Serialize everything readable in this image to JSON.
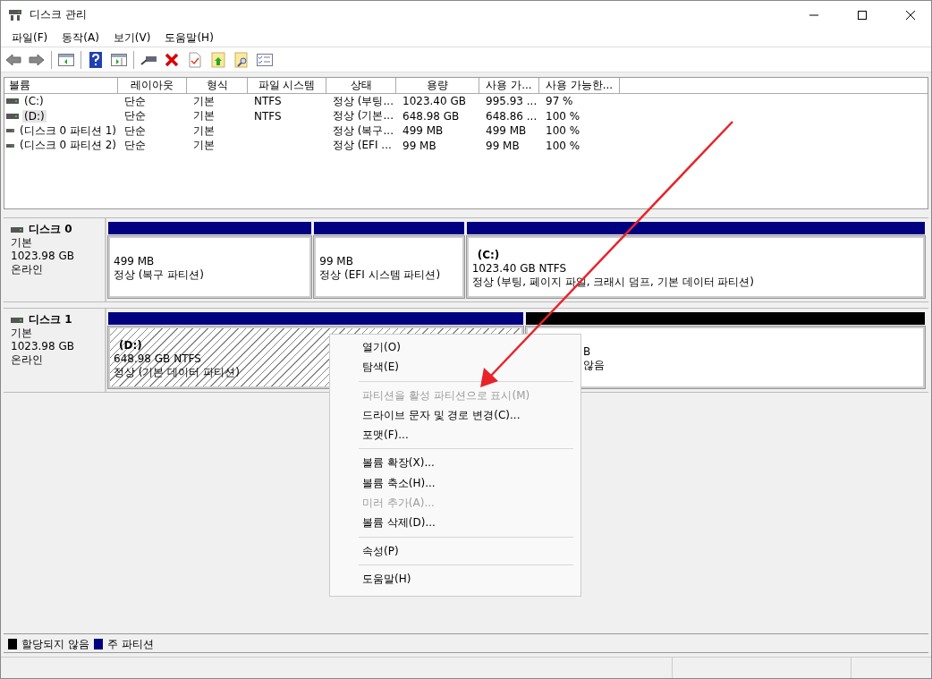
{
  "window": {
    "title": "디스크 관리"
  },
  "menu": [
    "파일(F)",
    "동작(A)",
    "보기(V)",
    "도움말(H)"
  ],
  "volume_table": {
    "columns": [
      "볼륨",
      "레이아웃",
      "형식",
      "파일 시스템",
      "상태",
      "용량",
      "사용 가...",
      "사용 가능한..."
    ],
    "rows": [
      {
        "selected": false,
        "cells": [
          "(C:)",
          "단순",
          "기본",
          "NTFS",
          "정상 (부팅...",
          "1023.40 GB",
          "995.93 ...",
          "97 %"
        ]
      },
      {
        "selected": true,
        "cells": [
          "(D:)",
          "단순",
          "기본",
          "NTFS",
          "정상 (기본...",
          "648.98 GB",
          "648.86 ...",
          "100 %"
        ]
      },
      {
        "selected": false,
        "cells": [
          "(디스크 0 파티션 1)",
          "단순",
          "기본",
          "",
          "정상 (복구...",
          "499 MB",
          "499 MB",
          "100 %"
        ]
      },
      {
        "selected": false,
        "cells": [
          "(디스크 0 파티션 2)",
          "단순",
          "기본",
          "",
          "정상 (EFI ...",
          "99 MB",
          "99 MB",
          "100 %"
        ]
      }
    ]
  },
  "disks": [
    {
      "name": "디스크 0",
      "type": "기본",
      "size": "1023.98 GB",
      "status": "온라인",
      "partitions": [
        {
          "kind": "primary",
          "selected": false,
          "size": "499 MB",
          "status": "정상 (복구 파티션)"
        },
        {
          "kind": "primary",
          "selected": false,
          "size": "99 MB",
          "status": "정상 (EFI 시스템 파티션)"
        },
        {
          "kind": "primary",
          "selected": false,
          "label": "(C:)",
          "size": "1023.40 GB NTFS",
          "status": "정상 (부팅, 페이지 파일, 크래시 덤프, 기본 데이터 파티션)"
        }
      ]
    },
    {
      "name": "디스크 1",
      "type": "기본",
      "size": "1023.98 GB",
      "status": "온라인",
      "partitions": [
        {
          "kind": "primary",
          "selected": true,
          "label": "(D:)",
          "size": "648.98 GB NTFS",
          "status": "정상 (기본 데이터 파티션)"
        },
        {
          "kind": "unallocated",
          "selected": false,
          "size": "B",
          "status": "않음"
        }
      ]
    }
  ],
  "context_menu": {
    "items": [
      {
        "kind": "item",
        "label": "열기(O)",
        "disabled": false
      },
      {
        "kind": "item",
        "label": "탐색(E)",
        "disabled": false
      },
      {
        "kind": "separator"
      },
      {
        "kind": "item",
        "label": "파티션을 활성 파티션으로 표시(M)",
        "disabled": true
      },
      {
        "kind": "item",
        "label": "드라이브 문자 및 경로 변경(C)...",
        "disabled": false
      },
      {
        "kind": "item",
        "label": "포맷(F)...",
        "disabled": false
      },
      {
        "kind": "separator"
      },
      {
        "kind": "item",
        "label": "볼륨 확장(X)...",
        "disabled": false
      },
      {
        "kind": "item",
        "label": "볼륨 축소(H)...",
        "disabled": false
      },
      {
        "kind": "item",
        "label": "미러 추가(A)...",
        "disabled": true
      },
      {
        "kind": "item",
        "label": "볼륨 삭제(D)...",
        "disabled": false
      },
      {
        "kind": "separator"
      },
      {
        "kind": "item",
        "label": "속성(P)",
        "disabled": false
      },
      {
        "kind": "separator"
      },
      {
        "kind": "item",
        "label": "도움말(H)",
        "disabled": false
      }
    ]
  },
  "legend": [
    {
      "label": "할당되지 않음",
      "color": "#000000"
    },
    {
      "label": "주 파티션",
      "color": "#000080"
    }
  ]
}
